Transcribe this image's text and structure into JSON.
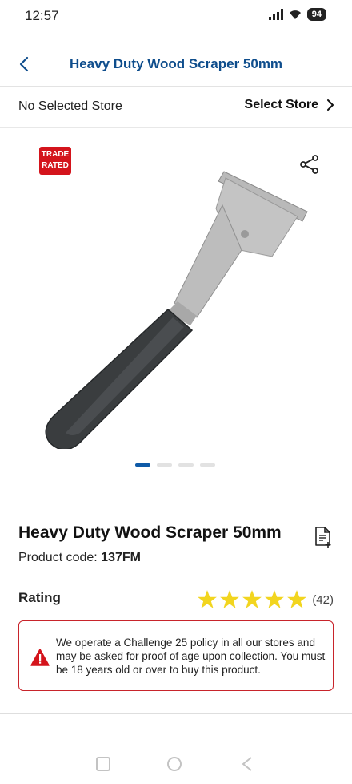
{
  "status_bar": {
    "time": "12:57",
    "battery": "94"
  },
  "header": {
    "title": "Heavy Duty Wood Scraper 50mm"
  },
  "store": {
    "label": "No Selected Store",
    "select_label": "Select Store"
  },
  "badge": {
    "line1": "TRADE",
    "line2": "RATED",
    "color": "#d4141c"
  },
  "gallery": {
    "slide_count": 4,
    "active_slide": 1
  },
  "product": {
    "title": "Heavy Duty Wood Scraper 50mm",
    "code_label": "Product code: ",
    "code_value": "137FM"
  },
  "rating": {
    "label": "Rating",
    "stars": 5,
    "count": "(42)",
    "star_color": "#f2d51f"
  },
  "notice": {
    "text": "We operate a Challenge 25 policy in all our stores and may be asked for proof of age upon collection. You must be 18 years old or over to buy this product.",
    "border_color": "#c8242b"
  },
  "colors": {
    "brand_blue": "#0e4d8c",
    "accent_blue": "#0e5aa7"
  }
}
